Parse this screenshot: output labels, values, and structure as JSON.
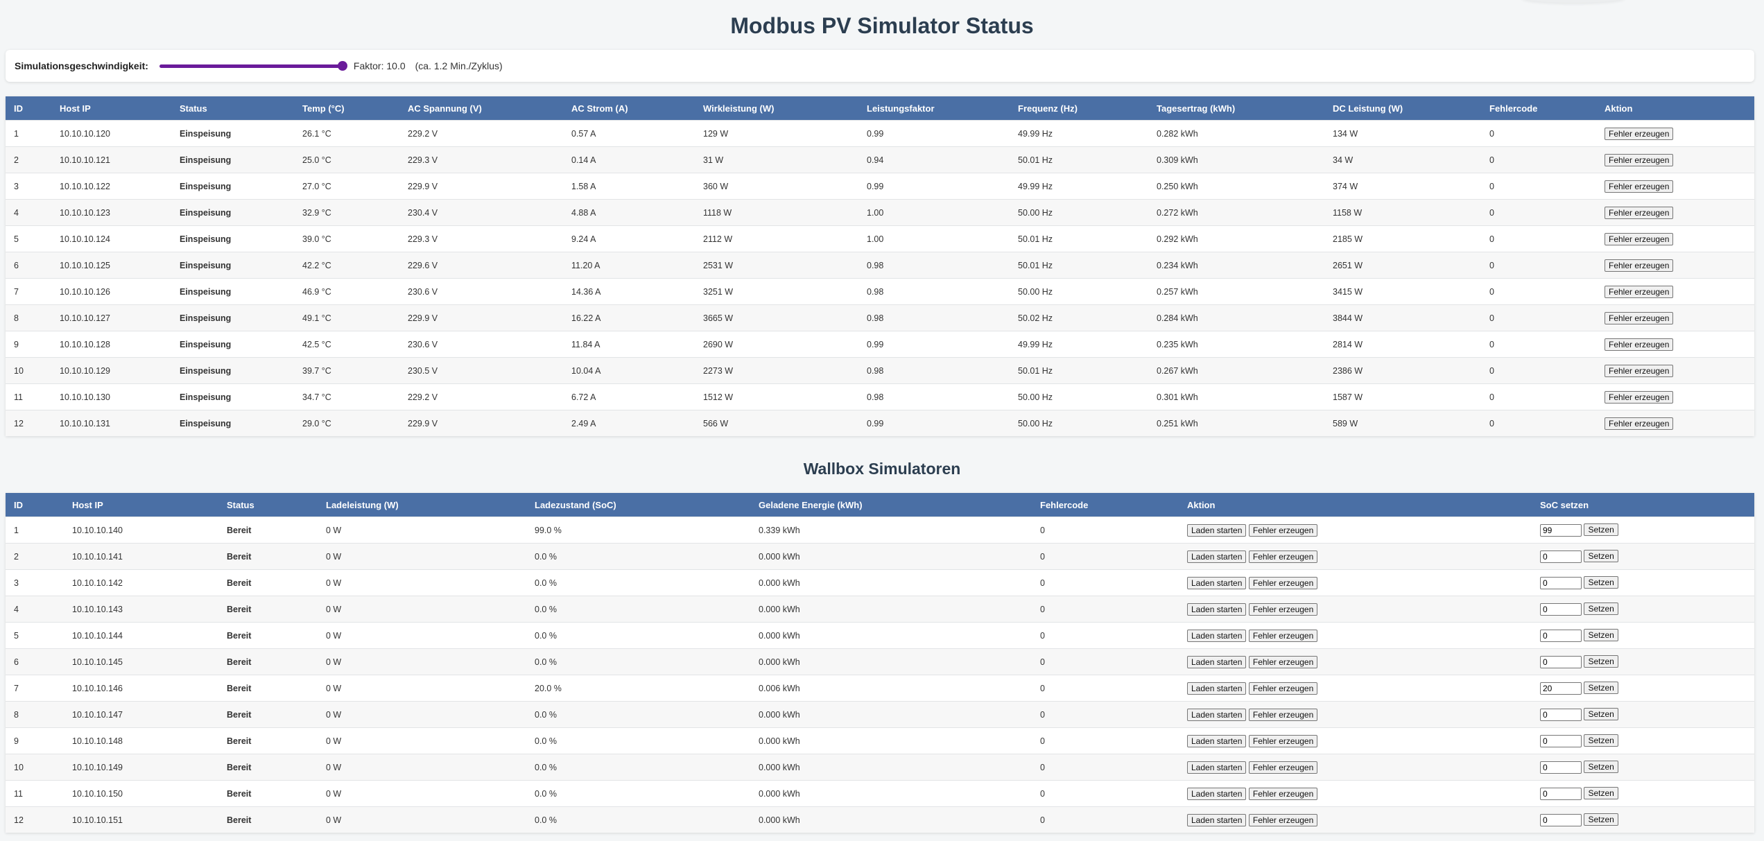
{
  "title": "Modbus PV Simulator Status",
  "speed": {
    "label": "Simulationsgeschwindigkeit:",
    "factor_text": "Faktor: 10.0",
    "note": "(ca. 1.2 Min./Zyklus)",
    "slider_fraction": 1.0,
    "slider_color": "#6a1b9a"
  },
  "pv": {
    "headers": [
      "ID",
      "Host IP",
      "Status",
      "Temp (°C)",
      "AC Spannung (V)",
      "AC Strom (A)",
      "Wirkleistung (W)",
      "Leistungsfaktor",
      "Frequenz (Hz)",
      "Tagesertrag (kWh)",
      "DC Leistung (W)",
      "Fehlercode",
      "Aktion"
    ],
    "action_label": "Fehler erzeugen",
    "status_color": "#1e9e3a",
    "rows": [
      [
        "1",
        "10.10.10.120",
        "Einspeisung",
        "26.1 °C",
        "229.2 V",
        "0.57 A",
        "129 W",
        "0.99",
        "49.99 Hz",
        "0.282 kWh",
        "134 W",
        "0"
      ],
      [
        "2",
        "10.10.10.121",
        "Einspeisung",
        "25.0 °C",
        "229.3 V",
        "0.14 A",
        "31 W",
        "0.94",
        "50.01 Hz",
        "0.309 kWh",
        "34 W",
        "0"
      ],
      [
        "3",
        "10.10.10.122",
        "Einspeisung",
        "27.0 °C",
        "229.9 V",
        "1.58 A",
        "360 W",
        "0.99",
        "49.99 Hz",
        "0.250 kWh",
        "374 W",
        "0"
      ],
      [
        "4",
        "10.10.10.123",
        "Einspeisung",
        "32.9 °C",
        "230.4 V",
        "4.88 A",
        "1118 W",
        "1.00",
        "50.00 Hz",
        "0.272 kWh",
        "1158 W",
        "0"
      ],
      [
        "5",
        "10.10.10.124",
        "Einspeisung",
        "39.0 °C",
        "229.3 V",
        "9.24 A",
        "2112 W",
        "1.00",
        "50.01 Hz",
        "0.292 kWh",
        "2185 W",
        "0"
      ],
      [
        "6",
        "10.10.10.125",
        "Einspeisung",
        "42.2 °C",
        "229.6 V",
        "11.20 A",
        "2531 W",
        "0.98",
        "50.01 Hz",
        "0.234 kWh",
        "2651 W",
        "0"
      ],
      [
        "7",
        "10.10.10.126",
        "Einspeisung",
        "46.9 °C",
        "230.6 V",
        "14.36 A",
        "3251 W",
        "0.98",
        "50.00 Hz",
        "0.257 kWh",
        "3415 W",
        "0"
      ],
      [
        "8",
        "10.10.10.127",
        "Einspeisung",
        "49.1 °C",
        "229.9 V",
        "16.22 A",
        "3665 W",
        "0.98",
        "50.02 Hz",
        "0.284 kWh",
        "3844 W",
        "0"
      ],
      [
        "9",
        "10.10.10.128",
        "Einspeisung",
        "42.5 °C",
        "230.6 V",
        "11.84 A",
        "2690 W",
        "0.99",
        "49.99 Hz",
        "0.235 kWh",
        "2814 W",
        "0"
      ],
      [
        "10",
        "10.10.10.129",
        "Einspeisung",
        "39.7 °C",
        "230.5 V",
        "10.04 A",
        "2273 W",
        "0.98",
        "50.01 Hz",
        "0.267 kWh",
        "2386 W",
        "0"
      ],
      [
        "11",
        "10.10.10.130",
        "Einspeisung",
        "34.7 °C",
        "229.2 V",
        "6.72 A",
        "1512 W",
        "0.98",
        "50.00 Hz",
        "0.301 kWh",
        "1587 W",
        "0"
      ],
      [
        "12",
        "10.10.10.131",
        "Einspeisung",
        "29.0 °C",
        "229.9 V",
        "2.49 A",
        "566 W",
        "0.99",
        "50.00 Hz",
        "0.251 kWh",
        "589 W",
        "0"
      ]
    ]
  },
  "wallbox": {
    "title": "Wallbox Simulatoren",
    "headers": [
      "ID",
      "Host IP",
      "Status",
      "Ladeleistung (W)",
      "Ladezustand (SoC)",
      "Geladene Energie (kWh)",
      "Fehlercode",
      "Aktion",
      "SoC setzen"
    ],
    "start_label": "Laden starten",
    "error_label": "Fehler erzeugen",
    "set_label": "Setzen",
    "status_color": "#f0910c",
    "rows": [
      [
        "1",
        "10.10.10.140",
        "Bereit",
        "0 W",
        "99.0 %",
        "0.339 kWh",
        "0",
        "99"
      ],
      [
        "2",
        "10.10.10.141",
        "Bereit",
        "0 W",
        "0.0 %",
        "0.000 kWh",
        "0",
        "0"
      ],
      [
        "3",
        "10.10.10.142",
        "Bereit",
        "0 W",
        "0.0 %",
        "0.000 kWh",
        "0",
        "0"
      ],
      [
        "4",
        "10.10.10.143",
        "Bereit",
        "0 W",
        "0.0 %",
        "0.000 kWh",
        "0",
        "0"
      ],
      [
        "5",
        "10.10.10.144",
        "Bereit",
        "0 W",
        "0.0 %",
        "0.000 kWh",
        "0",
        "0"
      ],
      [
        "6",
        "10.10.10.145",
        "Bereit",
        "0 W",
        "0.0 %",
        "0.000 kWh",
        "0",
        "0"
      ],
      [
        "7",
        "10.10.10.146",
        "Bereit",
        "0 W",
        "20.0 %",
        "0.006 kWh",
        "0",
        "20"
      ],
      [
        "8",
        "10.10.10.147",
        "Bereit",
        "0 W",
        "0.0 %",
        "0.000 kWh",
        "0",
        "0"
      ],
      [
        "9",
        "10.10.10.148",
        "Bereit",
        "0 W",
        "0.0 %",
        "0.000 kWh",
        "0",
        "0"
      ],
      [
        "10",
        "10.10.10.149",
        "Bereit",
        "0 W",
        "0.0 %",
        "0.000 kWh",
        "0",
        "0"
      ],
      [
        "11",
        "10.10.10.150",
        "Bereit",
        "0 W",
        "0.0 %",
        "0.000 kWh",
        "0",
        "0"
      ],
      [
        "12",
        "10.10.10.151",
        "Bereit",
        "0 W",
        "0.0 %",
        "0.000 kWh",
        "0",
        "0"
      ]
    ]
  }
}
